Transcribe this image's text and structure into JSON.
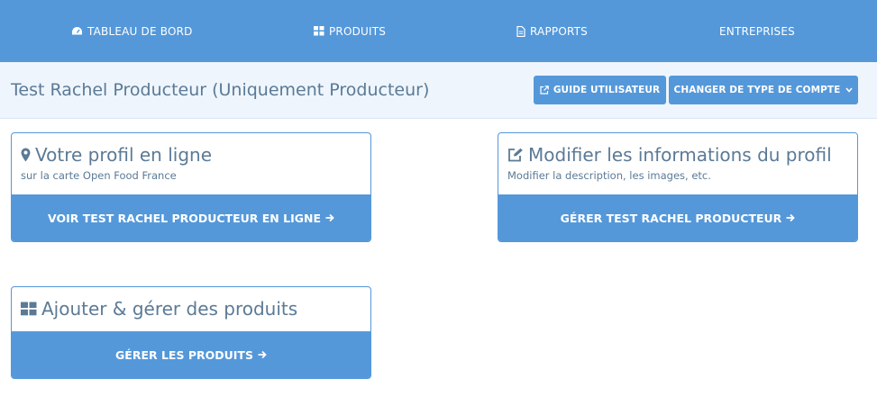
{
  "nav": {
    "items": [
      {
        "label": "TABLEAU DE BORD",
        "icon": "dashboard-icon"
      },
      {
        "label": "PRODUITS",
        "icon": "grid-icon"
      },
      {
        "label": "RAPPORTS",
        "icon": "file-icon"
      },
      {
        "label": "ENTREPRISES",
        "icon": ""
      }
    ]
  },
  "header": {
    "title": "Test Rachel Producteur (Uniquement Producteur)",
    "guide_label": "GUIDE UTILISATEUR",
    "account_label": "CHANGER DE TYPE DE COMPTE"
  },
  "cards": {
    "profile": {
      "title": "Votre profil en ligne",
      "subtitle": "sur la carte Open Food France",
      "button": "VOIR TEST RACHEL PRODUCTEUR EN LIGNE"
    },
    "edit": {
      "title": "Modifier les informations du profil",
      "subtitle": "Modifier la description, les images, etc.",
      "button": "GÉRER TEST RACHEL PRODUCTEUR"
    },
    "products": {
      "title": "Ajouter & gérer des produits",
      "button": "GÉRER LES PRODUITS"
    }
  },
  "colors": {
    "primary": "#5498da",
    "text": "#5b7a96",
    "subheader_bg": "#eef5fc"
  }
}
